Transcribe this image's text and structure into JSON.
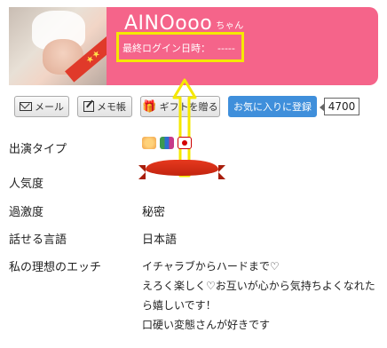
{
  "profile": {
    "name": "AINOooo",
    "name_suffix": "ちゃん",
    "last_login_label": "最終ログイン日時：",
    "last_login_value": "-----"
  },
  "actions": {
    "mail": "メール",
    "memo": "メモ帳",
    "gift": "ギフトを贈る",
    "favorite": "お気に入りに登録",
    "favorite_count": "4700"
  },
  "details": [
    {
      "label": "出演タイプ",
      "value": ""
    },
    {
      "label": "人気度",
      "value": ""
    },
    {
      "label": "過激度",
      "value": "秘密"
    },
    {
      "label": "話せる言語",
      "value": "日本語"
    },
    {
      "label": "私の理想のエッチ",
      "value": ""
    }
  ],
  "ideal_lines": [
    "イチャラブからハードまで♡",
    "えろく楽しく♡お互いが心から気持ちよくなれた",
    "ら嬉しいです！",
    "口硬い変態さんが好きです"
  ],
  "icons": [
    "mail-icon",
    "memo-icon",
    "gift-icon",
    "performer-type-icons",
    "rank-ribbon-icon",
    "arrow-annotation-icon"
  ],
  "colors": {
    "header_bg": "#f5648a",
    "highlight": "#f5e800",
    "favorite_btn": "#3f8fdb"
  }
}
